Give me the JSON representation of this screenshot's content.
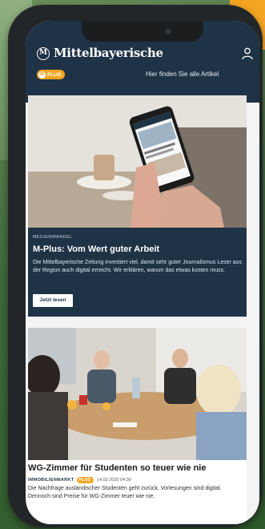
{
  "site": {
    "brand": "Mittelbayerische",
    "logo_letter": "M",
    "plus_badge": "PLUS",
    "promo_text": "Hier finden Sie alle Artikel",
    "colors": {
      "header": "#1f3346",
      "accent": "#f5a524"
    }
  },
  "icons": {
    "user": "user-icon",
    "logo": "mittelbayerische-logo-icon"
  },
  "articles": [
    {
      "kicker": "MEDIENWANDEL",
      "title": "M-Plus: Vom Wert guter Arbeit",
      "teaser": "Die Mittelbayerische Zeitung investiert viel, damit sehr guter Journalismus Leser aus der Region auch digital erreicht. Wir erklären, warum das etwas kosten muss.",
      "button": "Jetzt lesen"
    },
    {
      "title": "WG-Zimmer für Studenten so teuer wie nie",
      "kicker": "IMMOBILIENMARKT",
      "badge": "PLUS",
      "date": "14.02.2020 04:30",
      "teaser": "Die Nachfrage ausländischer Studenten geht zurück. Vorlesungen sind digital. Dennoch sind Preise für WG-Zimmer teuer wie nie."
    }
  ]
}
